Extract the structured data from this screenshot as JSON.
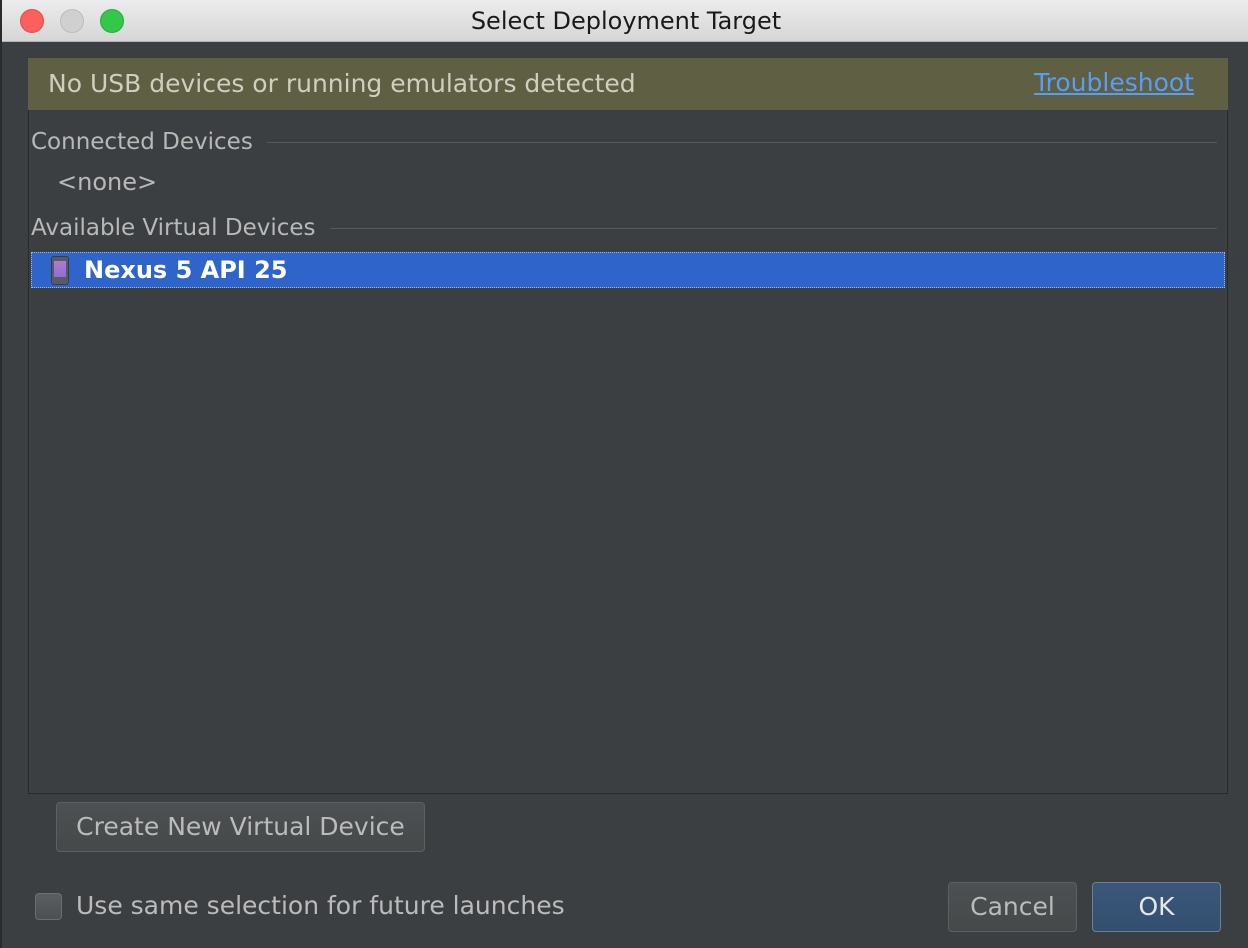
{
  "window": {
    "title": "Select Deployment Target"
  },
  "banner": {
    "message": "No USB devices or running emulators detected",
    "link_label": "Troubleshoot"
  },
  "sections": {
    "connected": {
      "label": "Connected Devices",
      "empty_text": "<none>"
    },
    "available": {
      "label": "Available Virtual Devices",
      "devices": [
        {
          "label": "Nexus 5 API 25",
          "icon": "phone-icon",
          "selected": true
        }
      ]
    }
  },
  "buttons": {
    "create_label": "Create New Virtual Device",
    "cancel_label": "Cancel",
    "ok_label": "OK"
  },
  "options": {
    "same_selection_label": "Use same selection for future launches",
    "same_selection_checked": false
  },
  "colors": {
    "selection": "#2f65ca",
    "banner_bg": "#5f5f44",
    "link": "#589df6",
    "background": "#3c3f41"
  }
}
